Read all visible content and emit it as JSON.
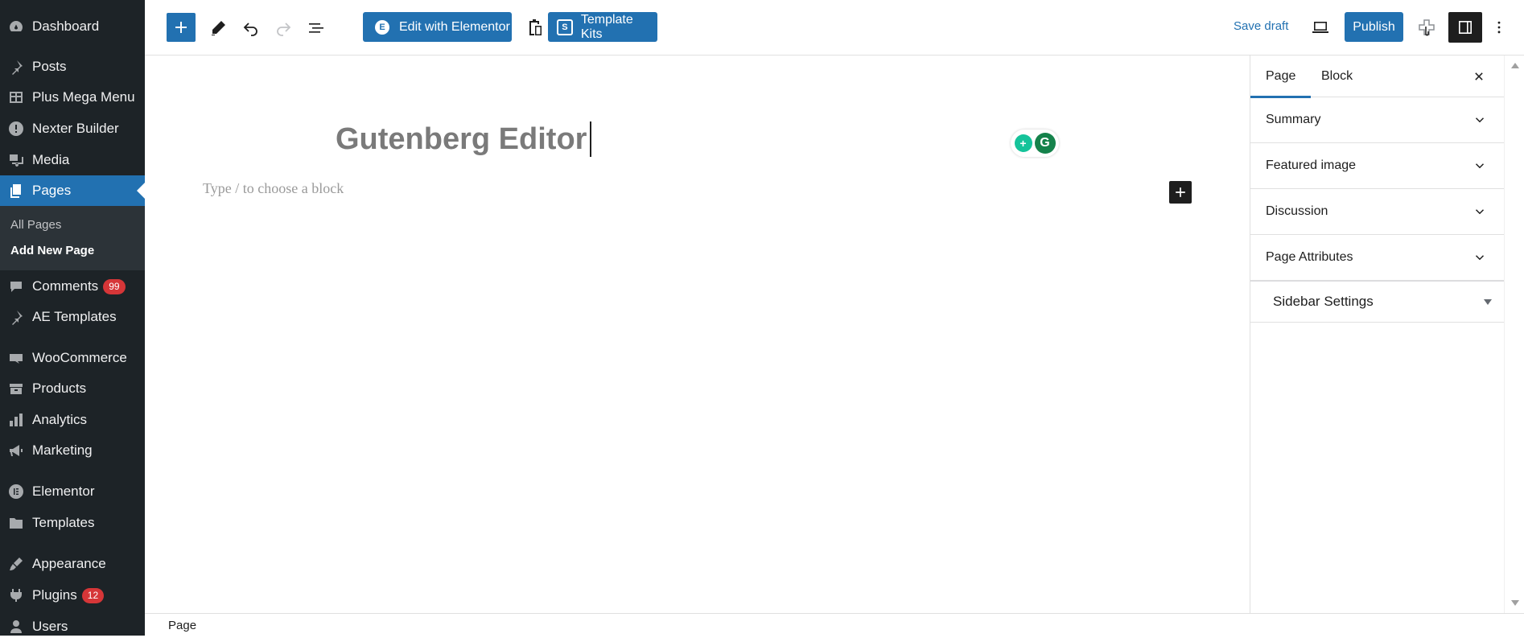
{
  "sidebar": {
    "items": [
      {
        "label": "Dashboard",
        "icon": "dashboard-icon"
      },
      {
        "label": "Posts",
        "icon": "pin-icon"
      },
      {
        "label": "Plus Mega Menu",
        "icon": "grid-icon"
      },
      {
        "label": "Nexter Builder",
        "icon": "alert-icon"
      },
      {
        "label": "Media",
        "icon": "media-icon"
      },
      {
        "label": "Pages",
        "icon": "pages-icon"
      },
      {
        "label": "Comments",
        "icon": "comment-icon",
        "badge": "99"
      },
      {
        "label": "AE Templates",
        "icon": "pin-icon"
      },
      {
        "label": "WooCommerce",
        "icon": "woo-icon"
      },
      {
        "label": "Products",
        "icon": "archive-icon"
      },
      {
        "label": "Analytics",
        "icon": "bar-chart-icon"
      },
      {
        "label": "Marketing",
        "icon": "megaphone-icon"
      },
      {
        "label": "Elementor",
        "icon": "elementor-icon"
      },
      {
        "label": "Templates",
        "icon": "folder-icon"
      },
      {
        "label": "Appearance",
        "icon": "brush-icon"
      },
      {
        "label": "Plugins",
        "icon": "plug-icon",
        "badge": "12"
      },
      {
        "label": "Users",
        "icon": "user-icon"
      }
    ],
    "submenu": [
      {
        "label": "All Pages"
      },
      {
        "label": "Add New Page"
      }
    ]
  },
  "toolbar": {
    "elementor_label": "Edit with Elementor",
    "template_kits_label": "Template Kits",
    "save_draft_label": "Save draft",
    "publish_label": "Publish"
  },
  "editor": {
    "title": "Gutenberg Editor",
    "block_placeholder": "Type / to choose a block"
  },
  "settings": {
    "tabs": [
      "Page",
      "Block"
    ],
    "panels": [
      "Summary",
      "Featured image",
      "Discussion",
      "Page Attributes"
    ],
    "sidebar_settings_label": "Sidebar Settings"
  },
  "footer": {
    "breadcrumb": "Page"
  },
  "colors": {
    "accent": "#2271b1",
    "sidebar_bg": "#1d2327",
    "badge": "#d63638"
  }
}
